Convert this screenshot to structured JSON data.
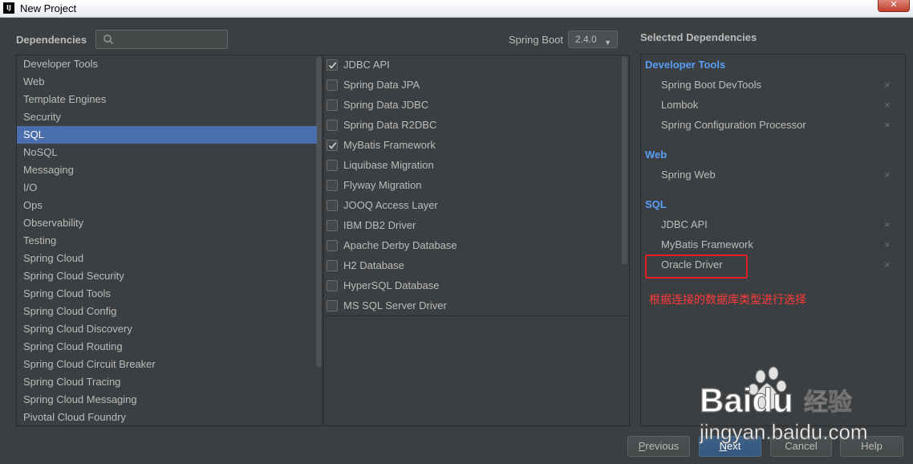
{
  "window": {
    "title": "New Project",
    "logo": "IJ",
    "close_label": "✕"
  },
  "header": {
    "dependencies_label": "Dependencies",
    "search": {
      "value": "",
      "placeholder": ""
    },
    "spring_boot_label": "Spring Boot",
    "spring_boot_version": "2.4.0"
  },
  "categories": [
    {
      "label": "Developer Tools",
      "selected": false
    },
    {
      "label": "Web",
      "selected": false
    },
    {
      "label": "Template Engines",
      "selected": false
    },
    {
      "label": "Security",
      "selected": false
    },
    {
      "label": "SQL",
      "selected": true
    },
    {
      "label": "NoSQL",
      "selected": false
    },
    {
      "label": "Messaging",
      "selected": false
    },
    {
      "label": "I/O",
      "selected": false
    },
    {
      "label": "Ops",
      "selected": false
    },
    {
      "label": "Observability",
      "selected": false
    },
    {
      "label": "Testing",
      "selected": false
    },
    {
      "label": "Spring Cloud",
      "selected": false
    },
    {
      "label": "Spring Cloud Security",
      "selected": false
    },
    {
      "label": "Spring Cloud Tools",
      "selected": false
    },
    {
      "label": "Spring Cloud Config",
      "selected": false
    },
    {
      "label": "Spring Cloud Discovery",
      "selected": false
    },
    {
      "label": "Spring Cloud Routing",
      "selected": false
    },
    {
      "label": "Spring Cloud Circuit Breaker",
      "selected": false
    },
    {
      "label": "Spring Cloud Tracing",
      "selected": false
    },
    {
      "label": "Spring Cloud Messaging",
      "selected": false
    },
    {
      "label": "Pivotal Cloud Foundry",
      "selected": false
    }
  ],
  "dependencies": [
    {
      "label": "JDBC API",
      "checked": true
    },
    {
      "label": "Spring Data JPA",
      "checked": false
    },
    {
      "label": "Spring Data JDBC",
      "checked": false
    },
    {
      "label": "Spring Data R2DBC",
      "checked": false
    },
    {
      "label": "MyBatis Framework",
      "checked": true
    },
    {
      "label": "Liquibase Migration",
      "checked": false
    },
    {
      "label": "Flyway Migration",
      "checked": false
    },
    {
      "label": "JOOQ Access Layer",
      "checked": false
    },
    {
      "label": "IBM DB2 Driver",
      "checked": false
    },
    {
      "label": "Apache Derby Database",
      "checked": false
    },
    {
      "label": "H2 Database",
      "checked": false
    },
    {
      "label": "HyperSQL Database",
      "checked": false
    },
    {
      "label": "MS SQL Server Driver",
      "checked": false
    }
  ],
  "selected_dependencies": {
    "title": "Selected Dependencies",
    "groups": [
      {
        "name": "Developer Tools",
        "items": [
          "Spring Boot DevTools",
          "Lombok",
          "Spring Configuration Processor"
        ]
      },
      {
        "name": "Web",
        "items": [
          "Spring Web"
        ]
      },
      {
        "name": "SQL",
        "items": [
          "JDBC API",
          "MyBatis Framework",
          "Oracle Driver"
        ]
      }
    ],
    "remove_glyph": "×",
    "annotation": "根据连接的数据库类型进行选择"
  },
  "footer": {
    "previous": {
      "prefix": "",
      "mnemonic": "P",
      "rest": "revious"
    },
    "next": {
      "prefix": "",
      "mnemonic": "N",
      "rest": "ext"
    },
    "cancel": "Cancel",
    "help": "Help"
  },
  "watermark": {
    "brand": "Baidu",
    "suffix": "经验",
    "url": "jingyan.baidu.com"
  },
  "colors": {
    "background": "#3c3f41",
    "selection": "#4b6eaf",
    "group_heading": "#589df6",
    "annotation": "#ff3a3a",
    "primary_button": "#365880"
  }
}
